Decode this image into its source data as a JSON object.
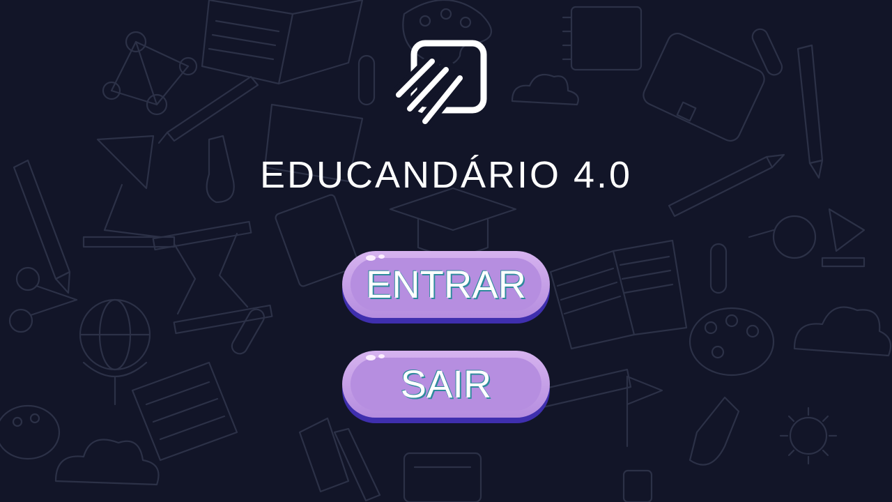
{
  "app": {
    "title": "EDUCANDÁRIO 4.0",
    "logo_icon": "hand-square-logo-icon"
  },
  "menu": {
    "enter_label": "ENTRAR",
    "exit_label": "SAIR"
  },
  "colors": {
    "background": "#121528",
    "doodle_stroke": "#2c3147",
    "button_face": "#b68ee0",
    "button_shadow": "#3f2fae",
    "label_outline": "#2e8a9c",
    "title": "#ffffff"
  }
}
